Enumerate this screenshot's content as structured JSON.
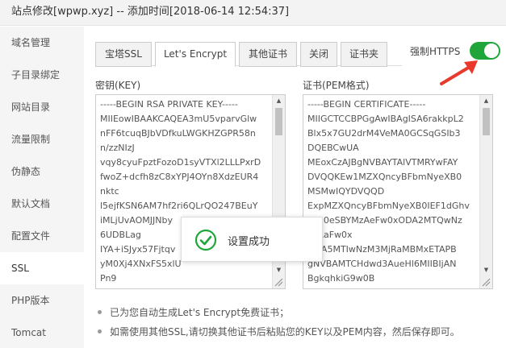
{
  "window": {
    "title": "站点修改[wpwp.xyz] -- 添加时间[2018-06-14 12:54:37]"
  },
  "sidebar": {
    "items": [
      {
        "label": "域名管理"
      },
      {
        "label": "子目录绑定"
      },
      {
        "label": "网站目录"
      },
      {
        "label": "流量限制"
      },
      {
        "label": "伪静态"
      },
      {
        "label": "默认文档"
      },
      {
        "label": "配置文件"
      },
      {
        "label": "SSL",
        "active": true
      },
      {
        "label": "PHP版本"
      },
      {
        "label": "Tomcat"
      }
    ]
  },
  "tabs": [
    {
      "label": "宝塔SSL"
    },
    {
      "label": "Let's Encrypt",
      "active": true
    },
    {
      "label": "其他证书"
    },
    {
      "label": "关闭"
    },
    {
      "label": "证书夹"
    }
  ],
  "https_toggle": {
    "label": "强制HTTPS",
    "on": true
  },
  "key_field": {
    "label": "密钥(KEY)",
    "lines": [
      "-----BEGIN RSA PRIVATE KEY-----",
      "MIIEowIBAAKCAQEA3mU5vparvGlw",
      "nFF6tcuqBJbVDfkuLWGKHZGPR58n",
      "n/zzNIzJ",
      "vqy8cyuFpztFozoD1syVTXl2LLLPxrD",
      "fwoZ+dcfh8zC8xYPJ4OYn8XdzEUR4",
      "nktc",
      "l5ejfKSN6AM7hf2ri6QLrQO247BEuY",
      "iMLjUvAOMJJNby",
      "6UDBLag",
      "IYA+iSJyx57Fjtqv",
      "yM0Xj4XNxFS5xlU",
      "Pn9"
    ]
  },
  "cert_field": {
    "label": "证书(PEM格式)",
    "lines": [
      "-----BEGIN CERTIFICATE-----",
      "MIIGCTCCBPGgAwIBAgISA6rakkpL2",
      "Blx5x7GU2drM4VeMA0GCSqGSIb3",
      "DQEBCwUA",
      "MEoxCzAJBgNVBAYTAlVTMRYwFAY",
      "DVQQKEw1MZXQncyBFbmNyeXB0",
      "MSMwIQYDVQQD",
      "ExpMZXQncyBFbmNyeXB0IEF1dGhv",
      "cml0eSBYMzAeFw0xODA2MTQwNz",
      "MjRaFw0x",
      "ODA5MTIwNzM3MjRaMBMxETAPB",
      "gNVBAMTCHdwd3AueHl6MIIBIjAN",
      "BgkqhkiG9w0B"
    ]
  },
  "toast": {
    "message": "设置成功"
  },
  "tips": [
    "已为您自动生成Let's Encrypt免费证书；",
    "如需使用其他SSL,请切换其他证书后粘贴您的KEY以及PEM内容，然后保存即可。"
  ],
  "colors": {
    "accent_green": "#20a53a",
    "arrow_red": "#e8392c"
  },
  "icons": {
    "toast": "check-circle-icon",
    "arrow": "red-arrow-icon",
    "grip": "resize-grip-icon"
  }
}
